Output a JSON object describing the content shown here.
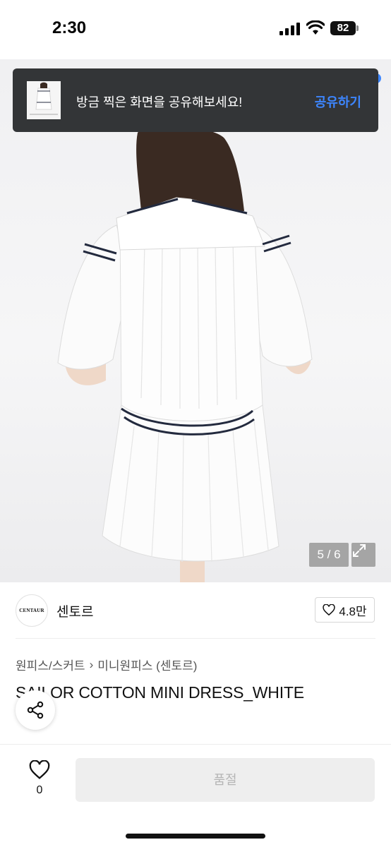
{
  "status_bar": {
    "time": "2:30",
    "battery": "82"
  },
  "toast": {
    "message": "방금 찍은 화면을 공유해보세요!",
    "action_label": "공유하기"
  },
  "gallery": {
    "counter": "5 / 6"
  },
  "brand": {
    "logo_text": "CENTAUR",
    "name": "센토르",
    "like_count": "4.8만"
  },
  "breadcrumb": {
    "category": "원피스/스커트",
    "separator": "›",
    "subcategory": "미니원피스 (센토르)"
  },
  "product": {
    "title": "SAILOR COTTON MINI DRESS_WHITE"
  },
  "bottom_bar": {
    "wish_count": "0",
    "buy_label": "품절"
  },
  "icons": [
    "signal-icon",
    "wifi-icon",
    "battery-icon",
    "expand-icon",
    "heart-icon",
    "share-icon"
  ],
  "colors": {
    "toast_bg": "#333537",
    "accent": "#3d86ff",
    "soldout_bg": "#eeeeee",
    "soldout_text": "#b5b5b5"
  }
}
